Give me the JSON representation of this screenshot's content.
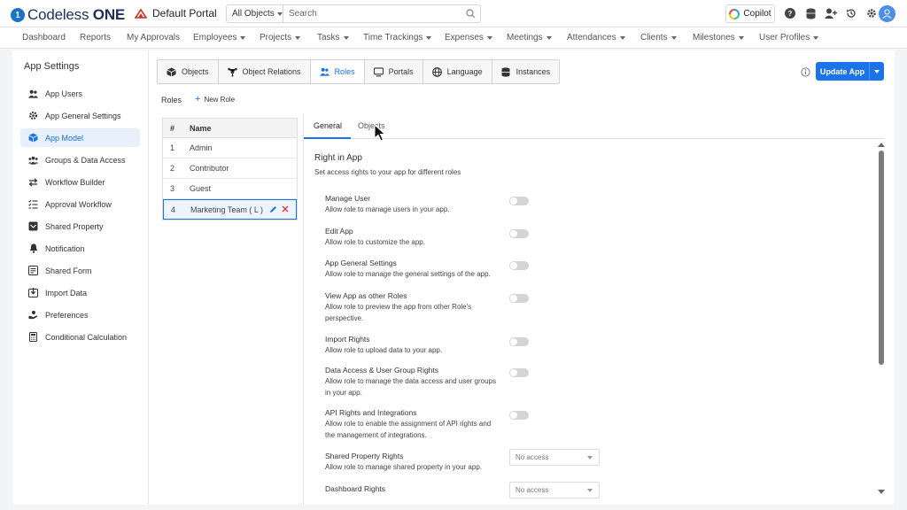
{
  "app": {
    "brand_prefix": "Codeless ",
    "brand_suffix": "ONE",
    "portal": "Default Portal"
  },
  "search": {
    "scope": "All Objects",
    "placeholder": "Search"
  },
  "copilot_label": "Copilot",
  "nav": [
    {
      "label": "Dashboard",
      "dropdown": false
    },
    {
      "label": "Reports",
      "dropdown": false
    },
    {
      "label": "My Approvals",
      "dropdown": false
    },
    {
      "label": "Employees",
      "dropdown": true
    },
    {
      "label": "Projects",
      "dropdown": true
    },
    {
      "label": "Tasks",
      "dropdown": true
    },
    {
      "label": "Time Trackings",
      "dropdown": true
    },
    {
      "label": "Expenses",
      "dropdown": true
    },
    {
      "label": "Meetings",
      "dropdown": true
    },
    {
      "label": "Attendances",
      "dropdown": true
    },
    {
      "label": "Clients",
      "dropdown": true
    },
    {
      "label": "Milestones",
      "dropdown": true
    },
    {
      "label": "User Profiles",
      "dropdown": true
    }
  ],
  "sidebar": {
    "title": "App Settings",
    "items": [
      {
        "label": "App Users",
        "icon": "users-icon"
      },
      {
        "label": "App General Settings",
        "icon": "gear-icon"
      },
      {
        "label": "App Model",
        "icon": "cube-icon",
        "active": true
      },
      {
        "label": "Groups & Data Access",
        "icon": "group-icon"
      },
      {
        "label": "Workflow Builder",
        "icon": "workflow-icon"
      },
      {
        "label": "Approval Workflow",
        "icon": "checklist-icon"
      },
      {
        "label": "Shared Property",
        "icon": "inbox-icon"
      },
      {
        "label": "Notification",
        "icon": "bell-icon"
      },
      {
        "label": "Shared Form",
        "icon": "form-icon"
      },
      {
        "label": "Import Data",
        "icon": "import-icon"
      },
      {
        "label": "Preferences",
        "icon": "hand-icon"
      },
      {
        "label": "Conditional Calculation",
        "icon": "calculator-icon"
      }
    ]
  },
  "tabs": [
    {
      "label": "Objects",
      "icon": "cube-icon"
    },
    {
      "label": "Object Relations",
      "icon": "relations-icon"
    },
    {
      "label": "Roles",
      "icon": "users-icon",
      "active": true
    },
    {
      "label": "Portals",
      "icon": "monitor-icon"
    },
    {
      "label": "Language",
      "icon": "globe-icon"
    },
    {
      "label": "Instances",
      "icon": "database-icon"
    }
  ],
  "update_button": "Update App",
  "roles": {
    "label": "Roles",
    "new_role": "New Role",
    "columns": [
      "#",
      "Name"
    ],
    "rows": [
      {
        "num": "1",
        "name": "Admin"
      },
      {
        "num": "2",
        "name": "Contributor"
      },
      {
        "num": "3",
        "name": "Guest"
      },
      {
        "num": "4",
        "name": "Marketing Team ( L )",
        "selected": true
      }
    ]
  },
  "detail": {
    "tabs": [
      "General",
      "Objects"
    ],
    "section_title": "Right in App",
    "section_subtitle": "Set access rights to your app for different roles",
    "permissions": [
      {
        "title": "Manage User",
        "desc": "Allow role to manage users in your app.",
        "control": "toggle",
        "enabled": false
      },
      {
        "title": "Edit App",
        "desc": "Allow role to customize the app.",
        "control": "toggle",
        "enabled": false
      },
      {
        "title": "App General Settings",
        "desc": "Allow role to manage the general settings of the app.",
        "control": "toggle",
        "enabled": false
      },
      {
        "title": "View App as other Roles",
        "desc": "Allow role to preview the app from other Role's perspective.",
        "control": "toggle",
        "enabled": false
      },
      {
        "title": "Import Rights",
        "desc": "Allow role to upload data to your app.",
        "control": "toggle",
        "enabled": false
      },
      {
        "title": "Data Access & User Group Rights",
        "desc": "Allow role to manage the data access and user groups in your app.",
        "control": "toggle",
        "enabled": false
      },
      {
        "title": "API Rights and Integrations",
        "desc": "Allow role to enable the assignment of API rights and the management of integrations.",
        "control": "toggle",
        "enabled": false
      },
      {
        "title": "Shared Property Rights",
        "desc": "Allow role to manage shared property in your app.",
        "control": "select",
        "value": "No access"
      },
      {
        "title": "Dashboard Rights",
        "desc": "",
        "control": "select",
        "value": "No access"
      }
    ]
  },
  "colors": {
    "accent": "#1a73e8",
    "brand": "#1d2f5a"
  }
}
